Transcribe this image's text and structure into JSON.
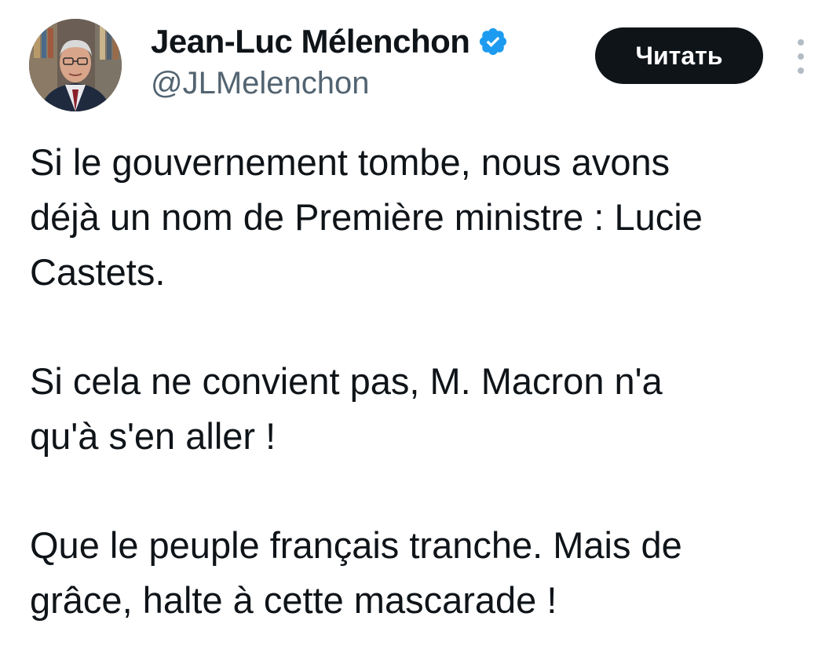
{
  "author": {
    "display_name": "Jean-Luc Mélenchon",
    "handle": "@JLMelenchon",
    "verified_icon": "verified-badge-icon",
    "avatar_icon": "profile-photo"
  },
  "actions": {
    "follow_label": "Читать",
    "more_icon": "more-vertical-icon"
  },
  "tweet": {
    "lines": [
      "Si le gouvernement tombe, nous avons",
      "déjà un nom de Première ministre : Lucie",
      "Castets.",
      "Si cela ne convient pas, M. Macron n'a",
      "qu'à s'en aller !",
      "Que le peuple français tranche. Mais de",
      "grâce, halte à cette mascarade !"
    ]
  },
  "colors": {
    "text": "#0f1419",
    "secondary_text": "#536471",
    "verified_blue": "#1d9bf0",
    "button_bg": "#0f1419",
    "button_text": "#ffffff"
  }
}
